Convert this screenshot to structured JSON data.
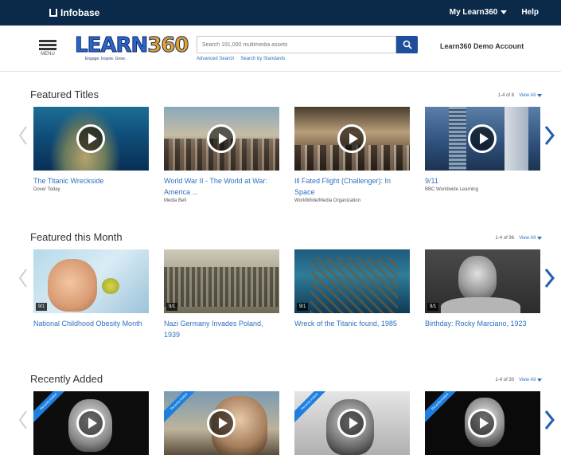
{
  "topbar": {
    "brand": "Infobase",
    "my_account": "My Learn360",
    "help": "Help"
  },
  "header": {
    "menu_label": "MENU",
    "logo_text_a": "LEARN",
    "logo_text_b": "360",
    "logo_tagline": "Engage. Inspire. Grow.",
    "search_placeholder": "Search 191,000 multimedia assets",
    "advanced_search": "Advanced Search",
    "search_by_standards": "Search by Standards",
    "account_name": "Learn360 Demo Account"
  },
  "sections": [
    {
      "title": "Featured Titles",
      "count": "1-4 of 8",
      "view_all": "View All",
      "cards": [
        {
          "title": "The Titanic Wreckside",
          "sub": "Dover Today",
          "thumb": "t-ocean",
          "play": true
        },
        {
          "title": "World War II - The World at War: America ...",
          "sub": "Media Bell",
          "thumb": "t-war",
          "play": true
        },
        {
          "title": "Ill Fated Flight (Challenger): In Space",
          "sub": "WorldWide/Media Organization",
          "thumb": "t-meeting",
          "play": true
        },
        {
          "title": "9/11",
          "sub": "BBC Worldwide Learning",
          "thumb": "t-city",
          "play": true
        }
      ]
    },
    {
      "title": "Featured this Month",
      "count": "1-4 of 96",
      "view_all": "View All",
      "cards": [
        {
          "title": "National Childhood Obesity Month",
          "sub": "",
          "thumb": "t-child",
          "cc": "9/1"
        },
        {
          "title": "Nazi Germany Invades Poland, 1939",
          "sub": "",
          "thumb": "t-army",
          "cc": "9/1"
        },
        {
          "title": "Wreck of the Titanic found, 1985",
          "sub": "",
          "thumb": "t-wreck",
          "cc": "9/1"
        },
        {
          "title": "Birthday: Rocky Marciano, 1923",
          "sub": "",
          "thumb": "t-boxer",
          "cc": "9/1"
        }
      ]
    },
    {
      "title": "Recently Added",
      "count": "1-4 of 30",
      "view_all": "View All",
      "cards": [
        {
          "thumb": "t-bw1",
          "play": true,
          "ribbon": "Recently Added"
        },
        {
          "thumb": "t-bw2",
          "play": true,
          "ribbon": "Recently Added"
        },
        {
          "thumb": "t-bw3",
          "play": true,
          "ribbon": "Recently Added"
        },
        {
          "thumb": "t-bw4",
          "play": true,
          "ribbon": "Recently Added"
        }
      ]
    }
  ],
  "colors": {
    "topbar": "#0b2a4a",
    "link": "#2f6fc1",
    "search_button": "#1f4e9a",
    "ribbon": "#1d7fe0"
  }
}
